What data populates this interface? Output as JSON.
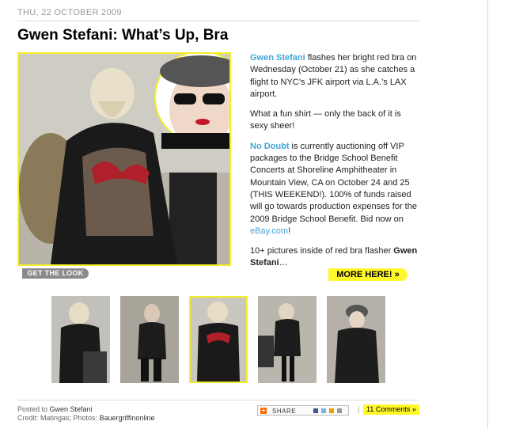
{
  "post": {
    "date": "THU, 22 OCTOBER 2009",
    "title": "Gwen Stefani: What’s Up, Bra",
    "get_look_label": "GET THE LOOK",
    "para1": {
      "link": "Gwen Stefani",
      "text": " flashes her bright red bra on Wednesday (October 21) as she catches a flight to NYC’s JFK airport via L.A.’s LAX airport."
    },
    "para2": "What a fun shirt — only the back of it is sexy sheer!",
    "para3": {
      "link": "No Doubt",
      "text": " is currently auctioning off VIP packages to the Bridge School Benefit Concerts at Shoreline Amphitheater in Mountain View, CA on October 24 and 25 (THIS WEEKEND!). 100% of funds raised will go towards production expenses for the 2009 Bridge School Benefit. Bid now on ",
      "link2": "eBay.com",
      "end": "!"
    },
    "para4": {
      "text": "10+ pictures inside of red bra flasher ",
      "bold": "Gwen Stefani",
      "end": "…"
    },
    "more_label": "MORE HERE! »"
  },
  "footer": {
    "posted_prefix": "Posted to ",
    "posted_category": "Gwen Stefani",
    "credit_prefix": "Credit: Matingas; Photos: ",
    "credit_agency": "Bauergriffinonline",
    "share_label": "SHARE",
    "pipe": "|",
    "comments_label": "11 Comments »"
  },
  "colors": {
    "accent_yellow": "#fff82a",
    "link_blue": "#3fa5d8"
  }
}
